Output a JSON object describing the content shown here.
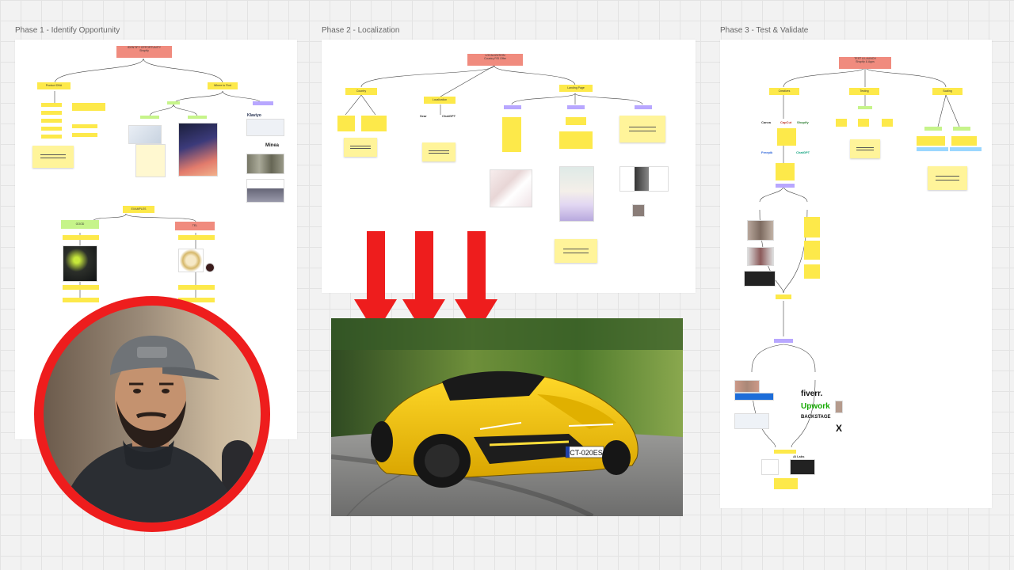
{
  "phases": {
    "p1": {
      "title": "Phase 1 - Identify Opportunity",
      "root": "IDENTIFY OPPORTUNITY",
      "root_sub": "Shopify",
      "product_dna": "Product DNA",
      "where_to_find": "Where to Find",
      "examples": "EXAMPLES",
      "good": "GOOD",
      "bad": "TEL",
      "brand1": "Klaviyo",
      "brand2": "Minea"
    },
    "p2": {
      "title": "Phase 2 - Localization",
      "root": "LOCALIZATION",
      "root_sub": "Country P/D Offer",
      "country": "Country",
      "localization": "Localization",
      "landing_page": "Landing Page",
      "app1": "Sear",
      "app2": "ChatGPT"
    },
    "p3": {
      "title": "Phase 3 - Test & Validate",
      "root": "TEST & LAUNCH",
      "root_sub": "Shopify & Apps",
      "creatives": "Creatives",
      "testing": "Testing",
      "scaling": "Scaling",
      "tool1": "Canva",
      "tool2": "CapCut",
      "tool3": "Shopify",
      "tool4": "Freepik",
      "tool5": "ChatGPT",
      "fiverr": "fiverr.",
      "upwork": "Upwork",
      "backstage": "BACKSTAGE",
      "x": "X",
      "ai": "AI Labs"
    }
  },
  "car": {
    "plate": "CT-020ES"
  },
  "colors": {
    "arrow": "#ee1d1d",
    "car_yellow": "#f2c20b",
    "avatar_ring": "#ee1d1d",
    "sticky": "#fff49a",
    "root_node": "#f08b7e"
  }
}
